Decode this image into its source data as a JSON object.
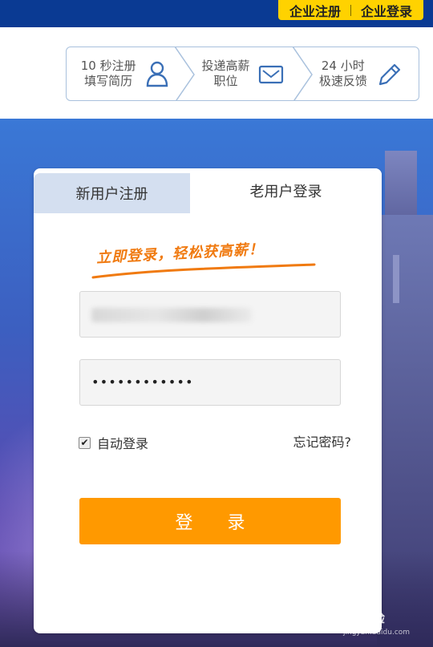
{
  "header": {
    "enterprise_register": "企业注册",
    "enterprise_login": "企业登录"
  },
  "steps": [
    {
      "line1": "10 秒注册",
      "line2": "填写简历",
      "icon": "person-icon"
    },
    {
      "line1": "投递高薪",
      "line2": "职位",
      "icon": "envelope-icon"
    },
    {
      "line1": "24 小时",
      "line2": "极速反馈",
      "icon": "pencil-icon"
    }
  ],
  "tabs": {
    "new_user": "新用户注册",
    "old_user": "老用户登录"
  },
  "slogan": "立即登录，轻松获高薪！",
  "form": {
    "password_mask": "••••••••••••",
    "remember_label": "自动登录",
    "remember_checked": true,
    "forgot_label": "忘记密码?",
    "login_button": "登 录"
  },
  "colors": {
    "brand_blue": "#0a3a93",
    "accent_yellow": "#ffd200",
    "login_orange": "#ff9900",
    "slogan_orange": "#f07a10"
  },
  "watermark": {
    "text": "Bai 经验",
    "sub": "jingyan.baidu.com"
  }
}
